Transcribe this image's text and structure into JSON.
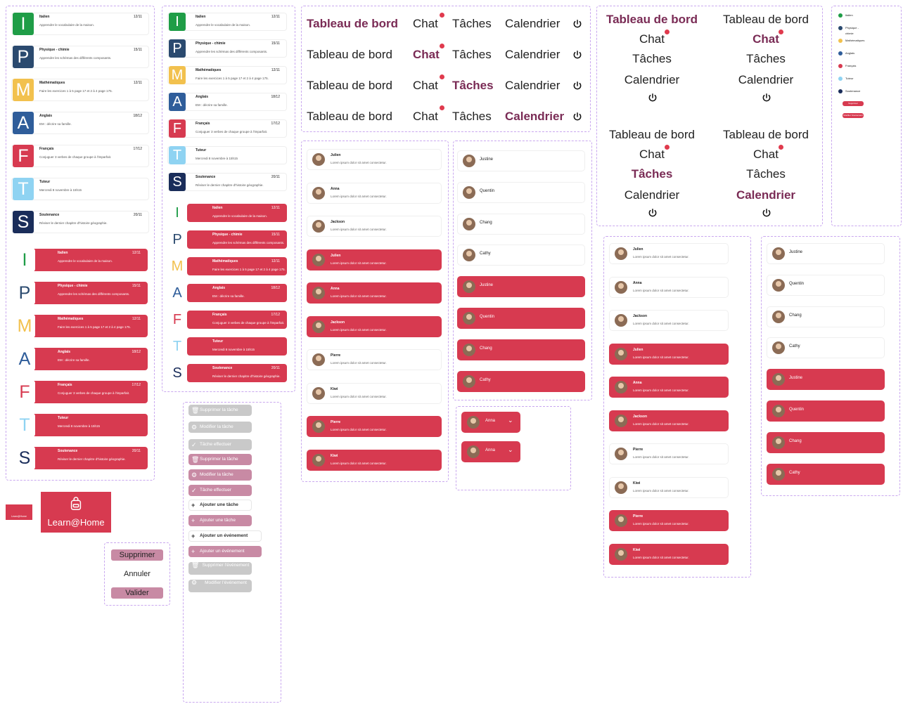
{
  "subjects": [
    {
      "letter": "I",
      "name": "Italien",
      "date": "12/11",
      "desc": "Apprendre le vocabulaire de la maison.",
      "color": "#1f9d47"
    },
    {
      "letter": "P",
      "name": "Physique - chimie",
      "date": "15/11",
      "desc": "Apprendre les schémas des différents composants.",
      "color": "#2b4a6f"
    },
    {
      "letter": "M",
      "name": "Mathématiques",
      "date": "12/11",
      "desc": "Faire les exercices 1 à 5 page 17 et 2 à 4 page 175.",
      "color": "#f2c14e"
    },
    {
      "letter": "A",
      "name": "Anglais",
      "date": "18/12",
      "desc": "EM : décrire sa famille.",
      "color": "#2f5d9a"
    },
    {
      "letter": "F",
      "name": "Français",
      "date": "17/12",
      "desc": "Conjuguer 3 verbes de chaque groupe à l'imparfait.",
      "color": "#d73a50"
    },
    {
      "letter": "T",
      "name": "Tuteur",
      "date": "",
      "desc": "Mercredi 8 novembre à 15h15",
      "color": "#8fd3f2"
    },
    {
      "letter": "S",
      "name": "Soutenance",
      "date": "20/11",
      "desc": "Réviser le dernier chapitre d'histoire géographie.",
      "color": "#1a2d5a"
    }
  ],
  "nav": {
    "dashboard": "Tableau de bord",
    "chat": "Chat",
    "tasks": "Tâches",
    "calendar": "Calendrier"
  },
  "chat_people": [
    {
      "name": "Julien",
      "msg": "Lorem ipsum dolor sit amet consectetur."
    },
    {
      "name": "Anna",
      "msg": "Lorem ipsum dolor sit amet consectetur."
    },
    {
      "name": "Jackson",
      "msg": "Lorem ipsum dolor sit amet consectetur."
    },
    {
      "name": "Pierre",
      "msg": "Lorem ipsum dolor sit amet consectetur."
    },
    {
      "name": "Kiwi",
      "msg": "Lorem ipsum dolor sit amet consectetur."
    }
  ],
  "people": [
    "Justine",
    "Quentin",
    "Chang",
    "Cathy"
  ],
  "selected_user": "Anna",
  "tasks": {
    "delete_task": "Supprimer la tâche",
    "edit_task": "Modifier la tâche",
    "task_done": "Tâche effectuer",
    "add_task": "Ajouter une tâche",
    "add_event": "Ajouter un événement",
    "delete_event": "Supprimer l'événement",
    "edit_event": "Modifier l'événement"
  },
  "dialog": {
    "delete": "Supprimer",
    "cancel": "Annuler",
    "validate": "Valider"
  },
  "logo": {
    "text": "Learn@Home",
    "small": "Learn@Home"
  },
  "colors": {
    "accent": "#d73a50",
    "active_text": "#7a2b55",
    "frame": "#c9a7ef"
  }
}
